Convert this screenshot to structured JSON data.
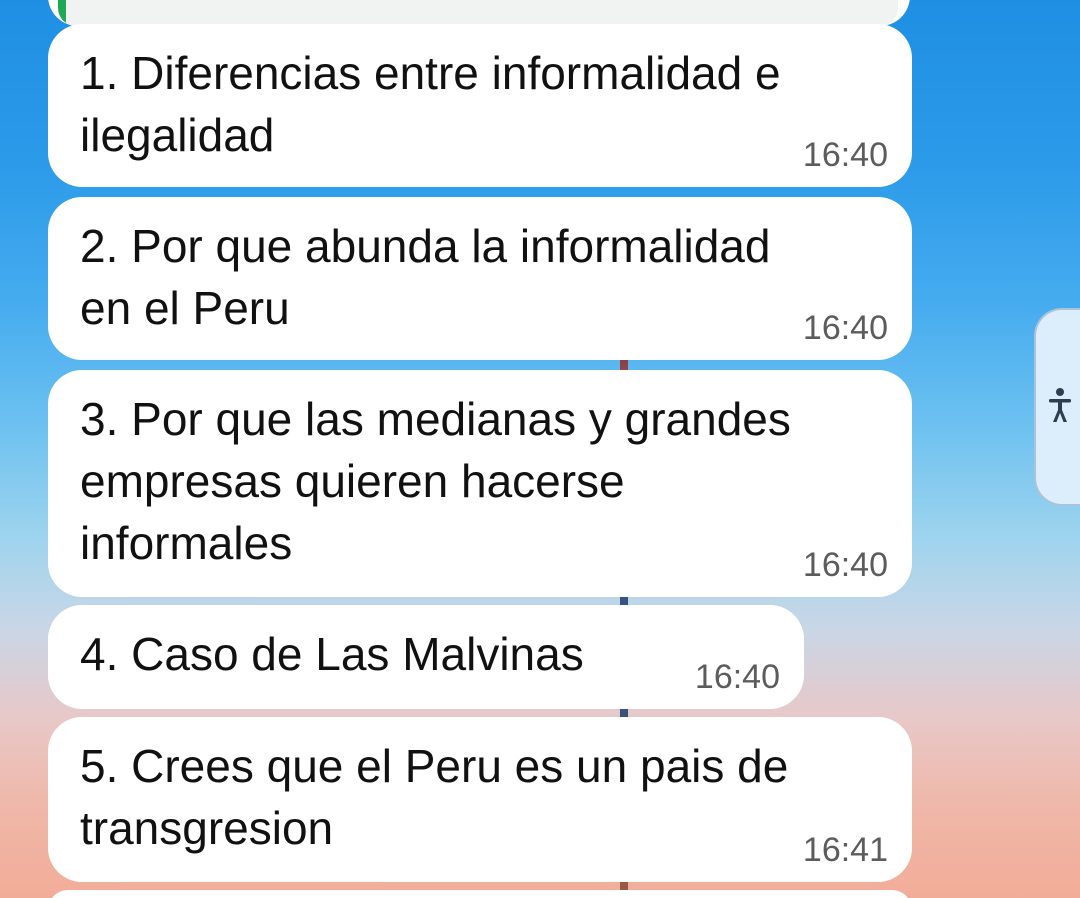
{
  "messages": [
    {
      "text": "1. Diferencias entre informalidad e\nilegalidad",
      "time": "16:40"
    },
    {
      "text": "2. Por que abunda la informalidad\nen el Peru",
      "time": "16:40"
    },
    {
      "text": "3. Por que las medianas y grandes\nempresas quieren hacerse\ninformales",
      "time": "16:40"
    },
    {
      "text": "4. Caso de Las Malvinas",
      "time": "16:40"
    },
    {
      "text": "5. Crees que el Peru es un pais de\ntransgresion",
      "time": "16:41"
    }
  ],
  "side_tab": {
    "icon": "accessibility-icon"
  },
  "colors": {
    "bubble": "#ffffff",
    "quote_bar": "#1fa855",
    "time": "#5c5c5c",
    "text": "#111111"
  }
}
